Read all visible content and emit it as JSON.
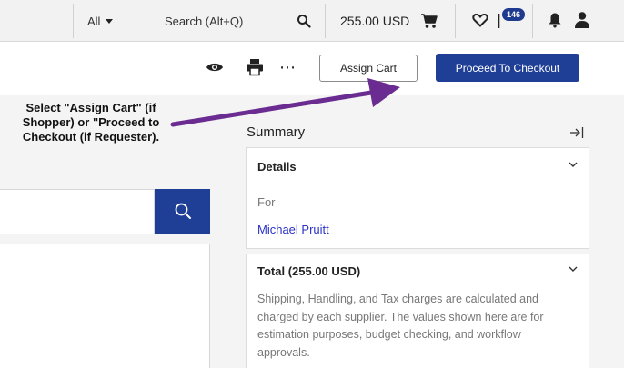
{
  "topbar": {
    "scope_label": "All",
    "search_placeholder": "Search (Alt+Q)",
    "cart_total": "255.00 USD",
    "notifications_badge": "146"
  },
  "actionbar": {
    "assign_label": "Assign Cart",
    "checkout_label": "Proceed To Checkout"
  },
  "callout": {
    "line1": "Select \"Assign Cart\" (if",
    "line2": "Shopper) or \"Proceed to",
    "line3": "Checkout (if Requester)."
  },
  "summary": {
    "title": "Summary",
    "details": {
      "heading": "Details",
      "for_label": "For",
      "for_name": "Michael Pruitt"
    },
    "total": {
      "heading": "Total (255.00 USD)",
      "note": "Shipping, Handling, and Tax charges are calculated and charged by each supplier. The values shown here are for estimation purposes, budget checking, and workflow approvals."
    }
  },
  "colors": {
    "primary": "#1f3f96",
    "arrow": "#6a2c91",
    "link": "#2b33c9"
  },
  "icons": [
    "search-icon",
    "cart-icon",
    "heart-icon",
    "flag-icon",
    "bell-icon",
    "user-icon",
    "eye-icon",
    "print-icon",
    "more-icon",
    "collapse-panel-icon",
    "chevron-down-icon"
  ]
}
